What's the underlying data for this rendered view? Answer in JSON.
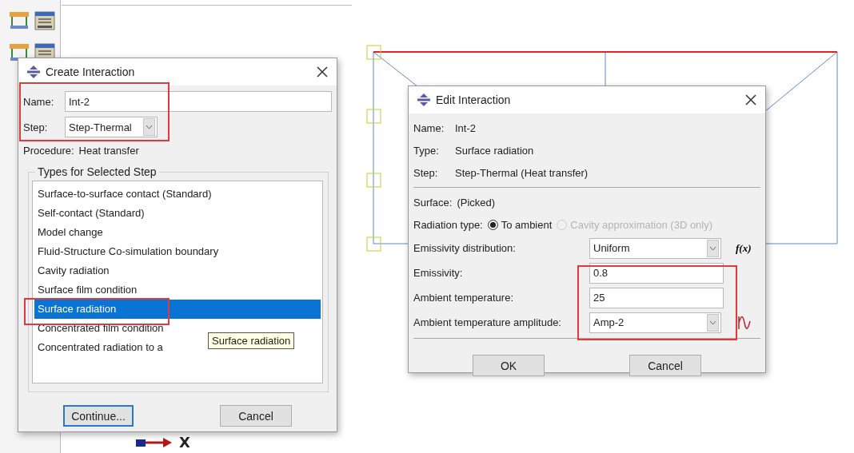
{
  "create_dialog": {
    "title": "Create Interaction",
    "name_label": "Name:",
    "name_value": "Int-2",
    "step_label": "Step:",
    "step_value": "Step-Thermal",
    "procedure_label": "Procedure:",
    "procedure_value": "Heat transfer",
    "group_title": "Types for Selected Step",
    "types": [
      {
        "label": "Surface-to-surface contact (Standard)",
        "selected": false
      },
      {
        "label": "Self-contact (Standard)",
        "selected": false
      },
      {
        "label": "Model change",
        "selected": false
      },
      {
        "label": "Fluid-Structure Co-simulation boundary",
        "selected": false
      },
      {
        "label": "Cavity radiation",
        "selected": false
      },
      {
        "label": "Surface film condition",
        "selected": false
      },
      {
        "label": "Surface radiation",
        "selected": true
      },
      {
        "label": "Concentrated film condition",
        "selected": false
      },
      {
        "label": "Concentrated radiation to a",
        "selected": false
      }
    ],
    "tooltip": "Surface radiation",
    "buttons": [
      {
        "label": "Continue...",
        "default": true
      },
      {
        "label": "Cancel",
        "default": false
      }
    ]
  },
  "axis_label": "X",
  "edit_dialog": {
    "title": "Edit Interaction",
    "info": [
      {
        "label": "Name:",
        "value": "Int-2"
      },
      {
        "label": "Type:",
        "value": "Surface radiation"
      },
      {
        "label": "Step:",
        "value": "Step-Thermal (Heat transfer)"
      }
    ],
    "surface_label": "Surface:",
    "surface_value": "(Picked)",
    "radiation_label": "Radiation type:",
    "radiation_options": [
      {
        "label": "To ambient",
        "selected": true,
        "disabled": false
      },
      {
        "label": "Cavity approximation (3D only)",
        "selected": false,
        "disabled": true
      }
    ],
    "fields": [
      {
        "kind": "select",
        "label": "Emissivity distribution:",
        "value": "Uniform",
        "button": "f(x)"
      },
      {
        "kind": "text",
        "label": "Emissivity:",
        "value": "0.8"
      },
      {
        "kind": "text",
        "label": "Ambient temperature:",
        "value": "25"
      },
      {
        "kind": "select",
        "label": "Ambient temperature amplitude:",
        "value": "Amp-2",
        "wave_button": true
      }
    ],
    "buttons": [
      {
        "label": "OK",
        "default": false
      },
      {
        "label": "Cancel",
        "default": false
      }
    ]
  }
}
